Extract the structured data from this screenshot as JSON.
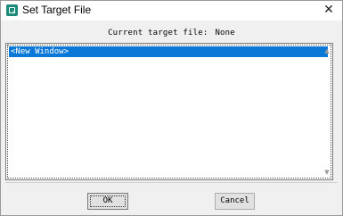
{
  "window": {
    "title": "Set Target File",
    "close_glyph": "✕"
  },
  "current_target": {
    "label": "Current target file:",
    "value": "None"
  },
  "list": {
    "items": [
      "<New Window>"
    ],
    "selected_index": 0
  },
  "buttons": {
    "ok_label": "OK",
    "cancel_label": "Cancel"
  },
  "colors": {
    "selection": "#0a78d7",
    "app_icon": "#1a8a7a"
  },
  "icons": {
    "app": "app-icon",
    "close": "close-icon",
    "scroll_up": "scroll-up-arrow-icon",
    "scroll_down": "scroll-down-arrow-icon"
  }
}
